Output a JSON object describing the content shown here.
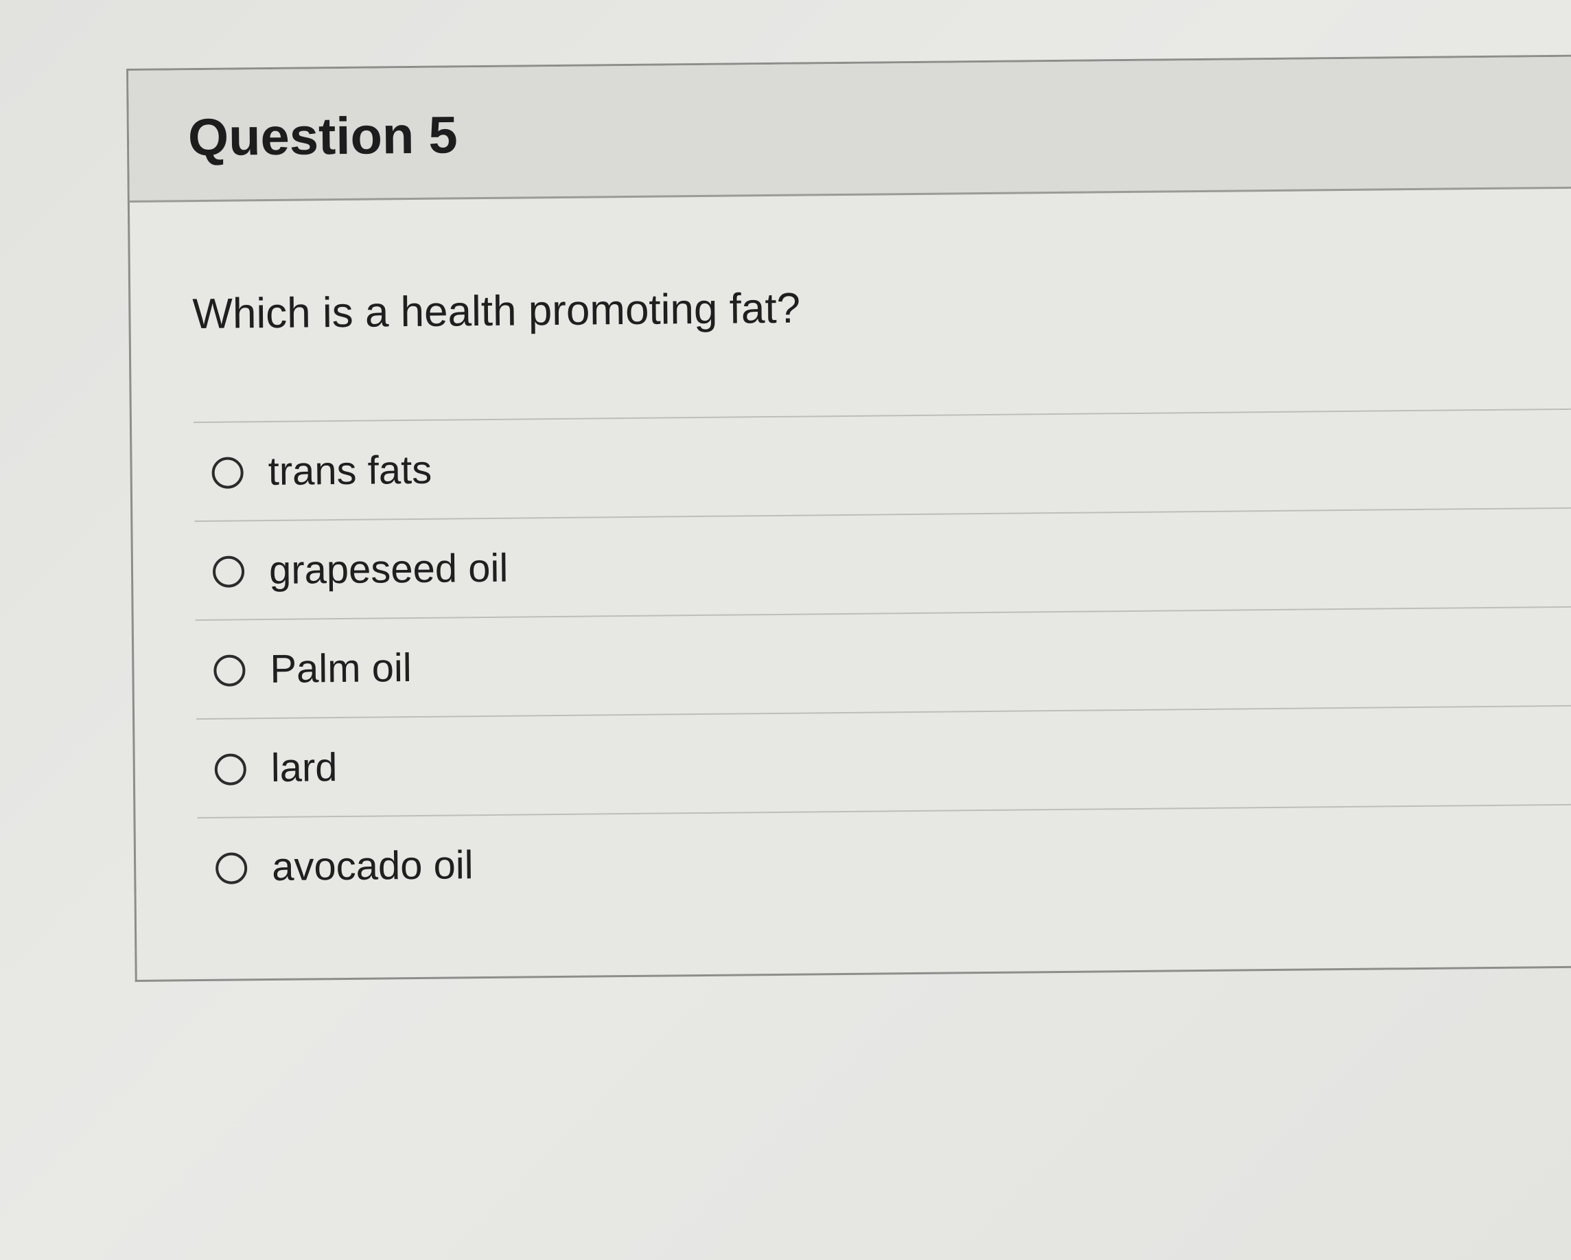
{
  "question": {
    "title": "Question 5",
    "prompt": "Which is a health promoting fat?",
    "answers": [
      {
        "label": "trans fats",
        "selected": false
      },
      {
        "label": "grapeseed oil",
        "selected": false
      },
      {
        "label": "Palm oil",
        "selected": false
      },
      {
        "label": "lard",
        "selected": false
      },
      {
        "label": "avocado oil",
        "selected": false
      }
    ]
  }
}
